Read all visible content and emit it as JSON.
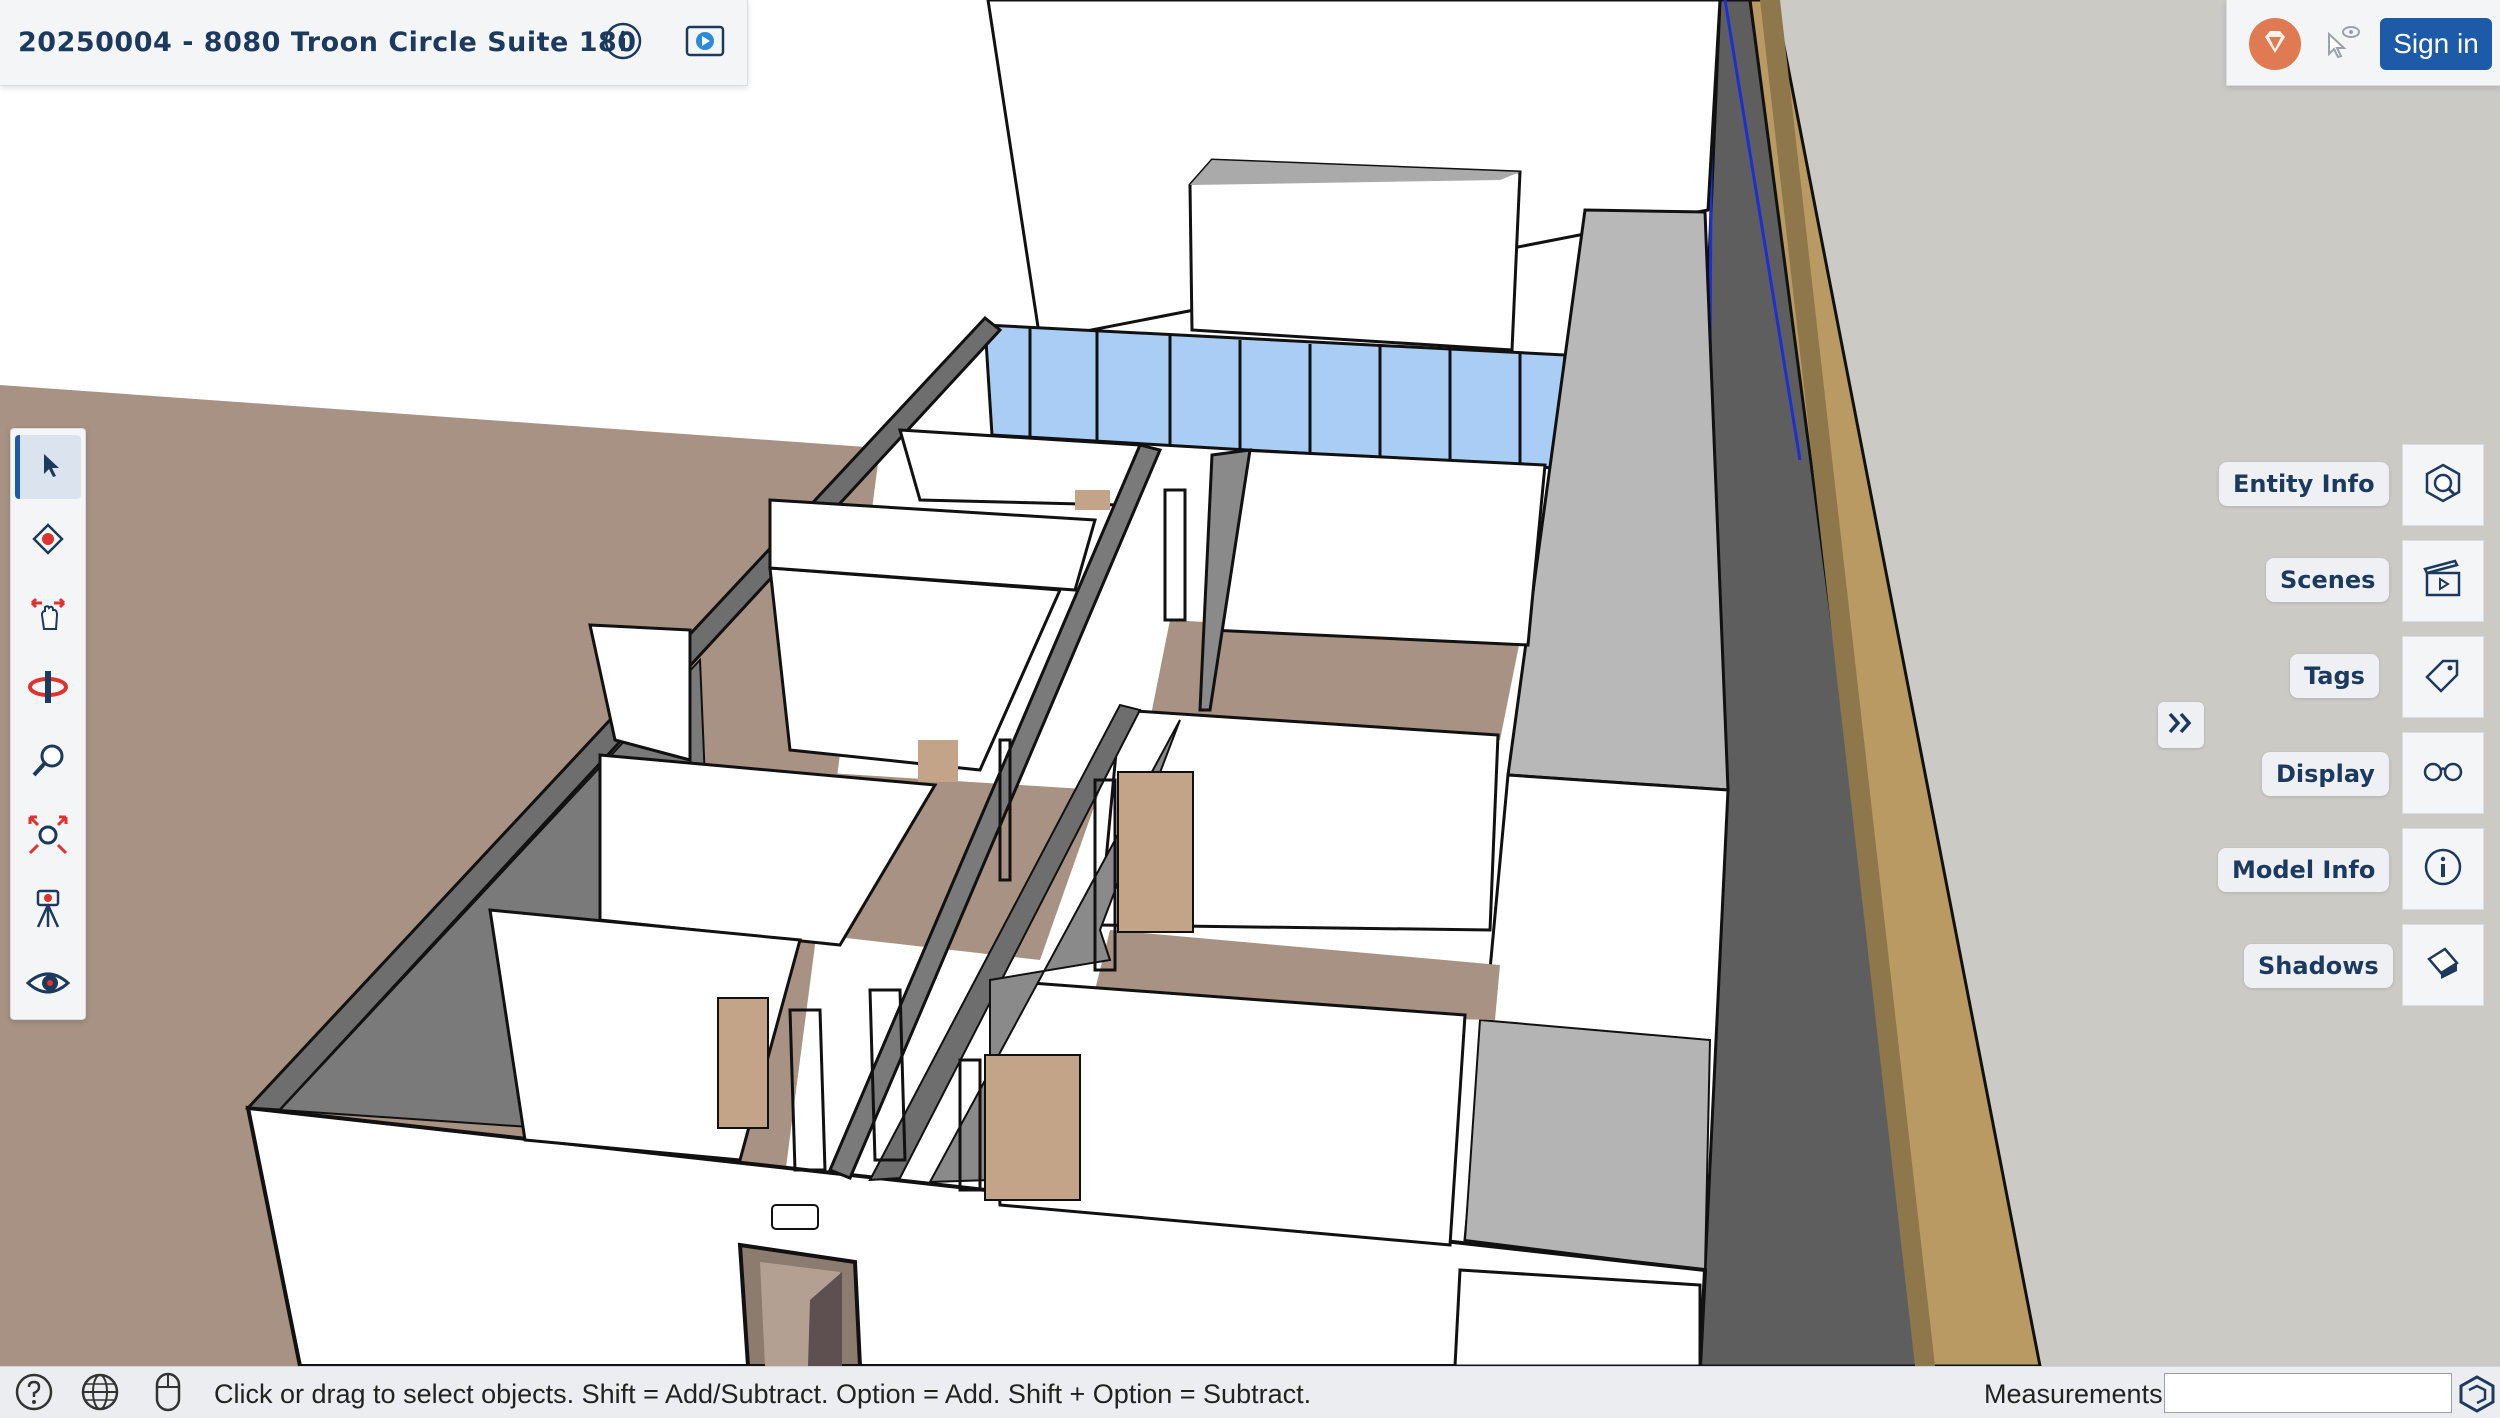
{
  "header": {
    "title": "20250004 - 8080 Troon Circle Suite 180",
    "info_icon": "info-circle-icon",
    "present_icon": "play-presentation-icon"
  },
  "account": {
    "sign_in_label": "Sign in",
    "profile_icon": "gem-badge-icon",
    "visibility_icon": "cursor-eye-icon",
    "accent": "#1d5aa8"
  },
  "toolbar": {
    "tools": [
      {
        "name": "select",
        "icon": "select-arrow-icon",
        "active": true
      },
      {
        "name": "paint",
        "icon": "paint-bucket-icon"
      },
      {
        "name": "pan",
        "icon": "pan-hand-icon"
      },
      {
        "name": "orbit",
        "icon": "orbit-icon"
      },
      {
        "name": "zoom",
        "icon": "zoom-magnifier-icon"
      },
      {
        "name": "zoom-extents",
        "icon": "zoom-extents-icon"
      },
      {
        "name": "position-camera",
        "icon": "camera-tripod-icon"
      },
      {
        "name": "look-around",
        "icon": "eye-icon"
      }
    ]
  },
  "panels": {
    "items": [
      {
        "label": "Entity Info",
        "icon": "entity-info-icon"
      },
      {
        "label": "Scenes",
        "icon": "clapperboard-icon"
      },
      {
        "label": "Tags",
        "icon": "tag-icon"
      },
      {
        "label": "Display",
        "icon": "glasses-icon"
      },
      {
        "label": "Model Info",
        "icon": "info-circle-icon"
      },
      {
        "label": "Shadows",
        "icon": "shadows-icon"
      }
    ],
    "expand_icon": "double-chevron-right-icon"
  },
  "statusbar": {
    "hint": "Click or drag to select objects. Shift = Add/Subtract. Option = Add. Shift + Option = Subtract.",
    "measurements_label": "Measurements",
    "measurements_value": "",
    "icons": [
      "help-icon",
      "globe-icon",
      "mouse-icon"
    ]
  },
  "colors": {
    "floor": "#a79283",
    "wall_white": "#ffffff",
    "wall_grey": "#7a7a7a",
    "glass": "#a9cdf5",
    "door": "#c4a489",
    "ground_right": "#cbcac5",
    "exterior_tan": "#b89a62"
  }
}
